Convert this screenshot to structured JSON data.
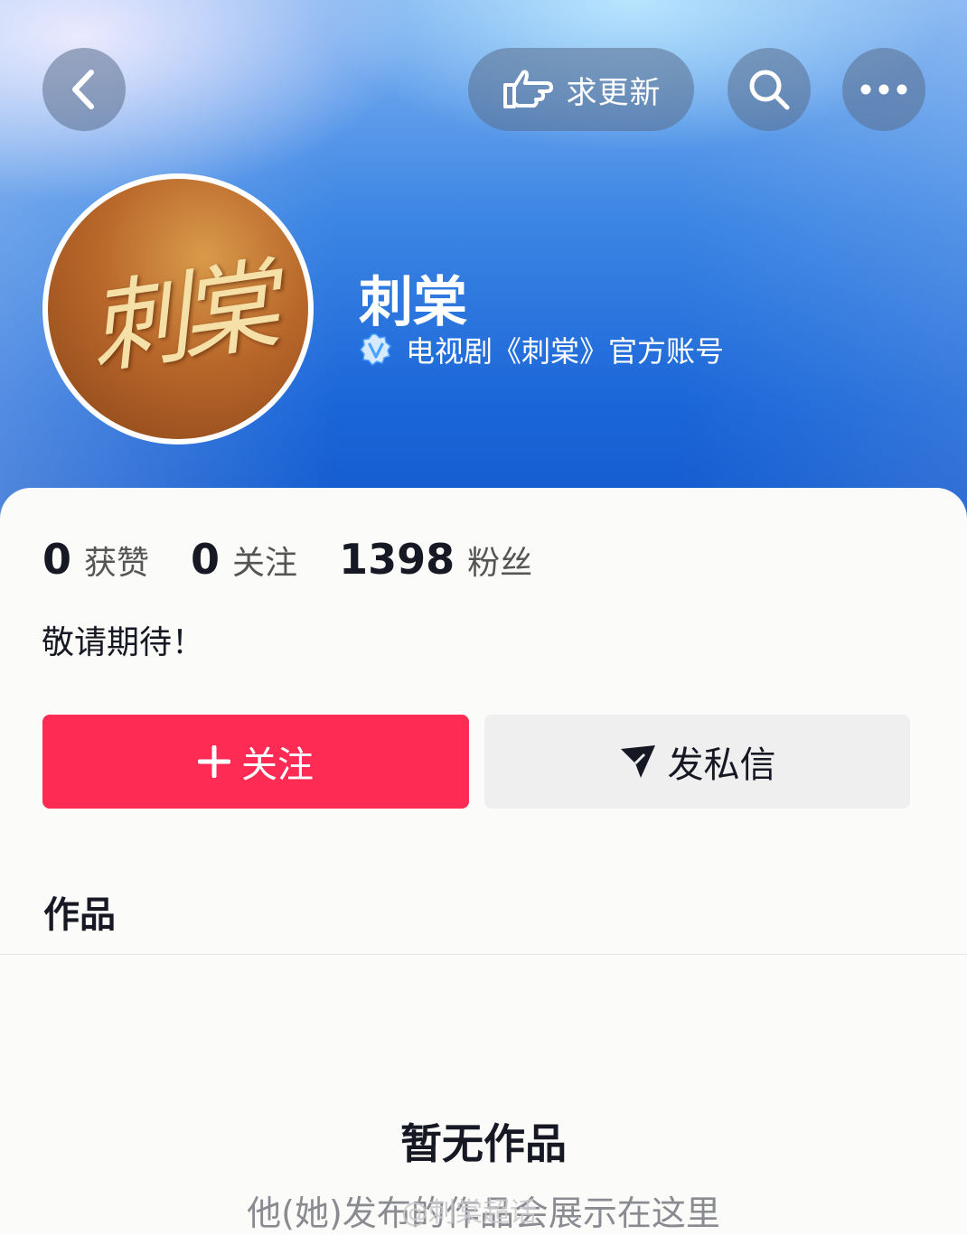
{
  "top_bar": {
    "request_update_label": "求更新"
  },
  "profile": {
    "name": "刺棠",
    "verification": "电视剧《刺棠》官方账号",
    "avatar_text": "刺棠",
    "bio": "敬请期待！"
  },
  "stats": [
    {
      "value": "0",
      "label": "获赞"
    },
    {
      "value": "0",
      "label": "关注"
    },
    {
      "value": "1398",
      "label": "粉丝"
    }
  ],
  "actions": {
    "follow_label": "关注",
    "message_label": "发私信"
  },
  "works": {
    "title": "作品",
    "empty_title": "暂无作品",
    "empty_subtitle": "他(她)发布的作品会展示在这里"
  },
  "watermark": "@刺棠超话",
  "colors": {
    "accent": "#fe2c55",
    "hero_blue": "#1a66d8",
    "verify_blue": "#4aa3ff"
  },
  "icons": [
    "back-icon",
    "hand-point-icon",
    "search-icon",
    "more-icon",
    "verified-icon",
    "plus-icon",
    "send-icon"
  ]
}
